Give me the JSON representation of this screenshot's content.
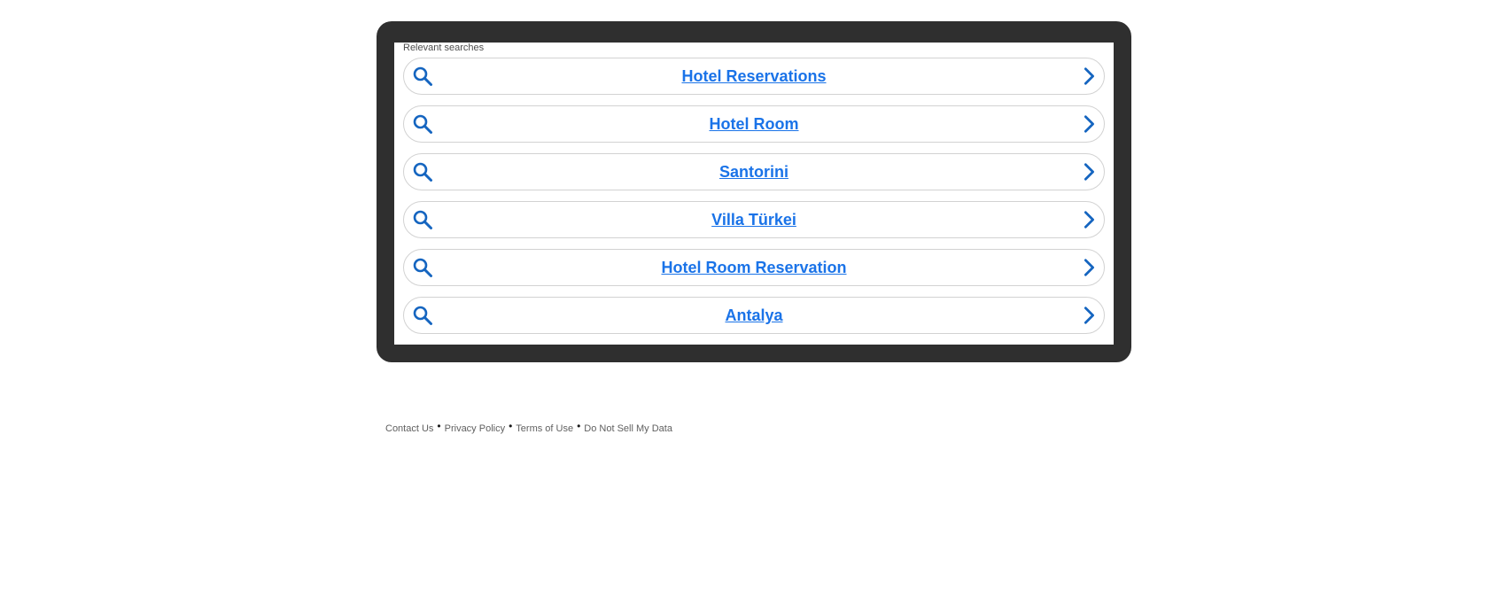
{
  "panel": {
    "label": "Relevant searches"
  },
  "results": [
    {
      "label": "Hotel Reservations"
    },
    {
      "label": "Hotel Room"
    },
    {
      "label": "Santorini"
    },
    {
      "label": "Villa Türkei"
    },
    {
      "label": "Hotel Room Reservation"
    },
    {
      "label": "Antalya"
    }
  ],
  "footer": {
    "links": [
      {
        "label": "Contact Us"
      },
      {
        "label": "Privacy Policy"
      },
      {
        "label": "Terms of Use"
      },
      {
        "label": "Do Not Sell My Data"
      }
    ],
    "separator": "•"
  },
  "colors": {
    "frame": "#2f2f2f",
    "link": "#1a73e8",
    "icon": "#1565c0",
    "border": "#d2d2d2"
  },
  "icons": {
    "result_leading": "search-icon",
    "result_trailing": "chevron-right-icon"
  }
}
